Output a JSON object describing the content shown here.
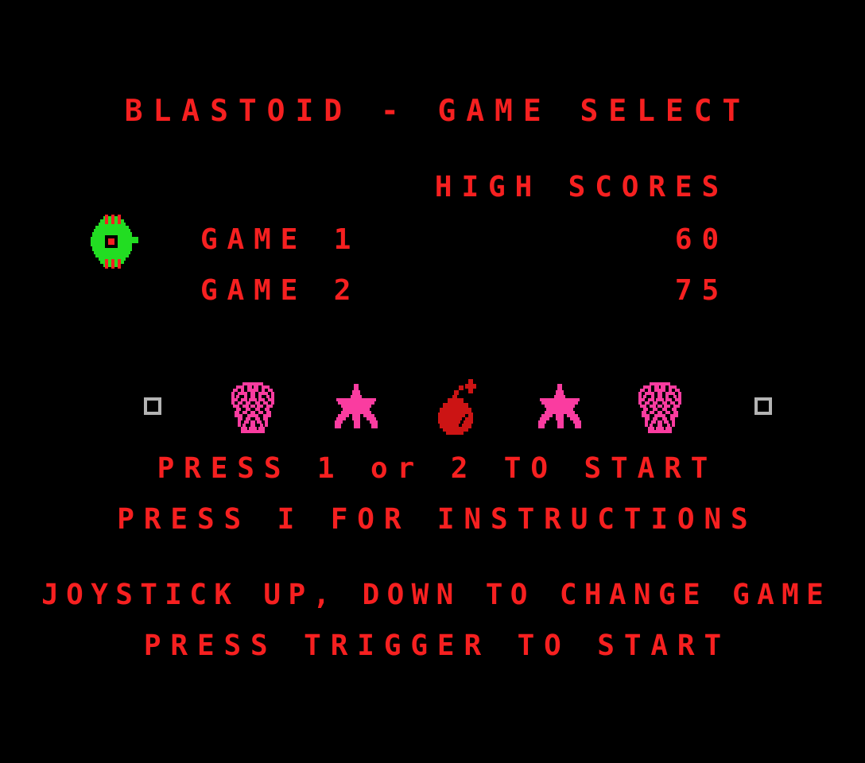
{
  "screen": {
    "background_color": "#000000",
    "text_color": "#f62020",
    "accent_pink": "#fa3ca0",
    "accent_green": "#22dd22",
    "accent_gray": "#b4b4b4",
    "bomb_color": "#cc1414"
  },
  "title": "BLASTOID - GAME SELECT",
  "high_scores": {
    "heading": "HIGH SCORES",
    "rows": [
      {
        "label": "GAME 1",
        "score": "60"
      },
      {
        "label": "GAME 2",
        "score": "75"
      }
    ]
  },
  "cursor": {
    "icon": "ship-cursor-icon",
    "points_to_row": "GAME 1"
  },
  "decor_row": [
    {
      "icon": "square-outline-icon",
      "color": "#b4b4b4"
    },
    {
      "icon": "mask-skull-icon",
      "color": "#fa3ca0"
    },
    {
      "icon": "star-icon",
      "color": "#fa3ca0"
    },
    {
      "icon": "bomb-icon",
      "color": "#cc1414"
    },
    {
      "icon": "star-icon",
      "color": "#fa3ca0"
    },
    {
      "icon": "mask-skull-icon",
      "color": "#fa3ca0"
    },
    {
      "icon": "square-outline-icon",
      "color": "#b4b4b4"
    }
  ],
  "prompts": {
    "press_start": "PRESS 1 or 2 TO START",
    "press_instructions": "PRESS I FOR INSTRUCTIONS",
    "joystick": "JOYSTICK UP, DOWN TO CHANGE GAME",
    "trigger": "PRESS TRIGGER TO START"
  }
}
